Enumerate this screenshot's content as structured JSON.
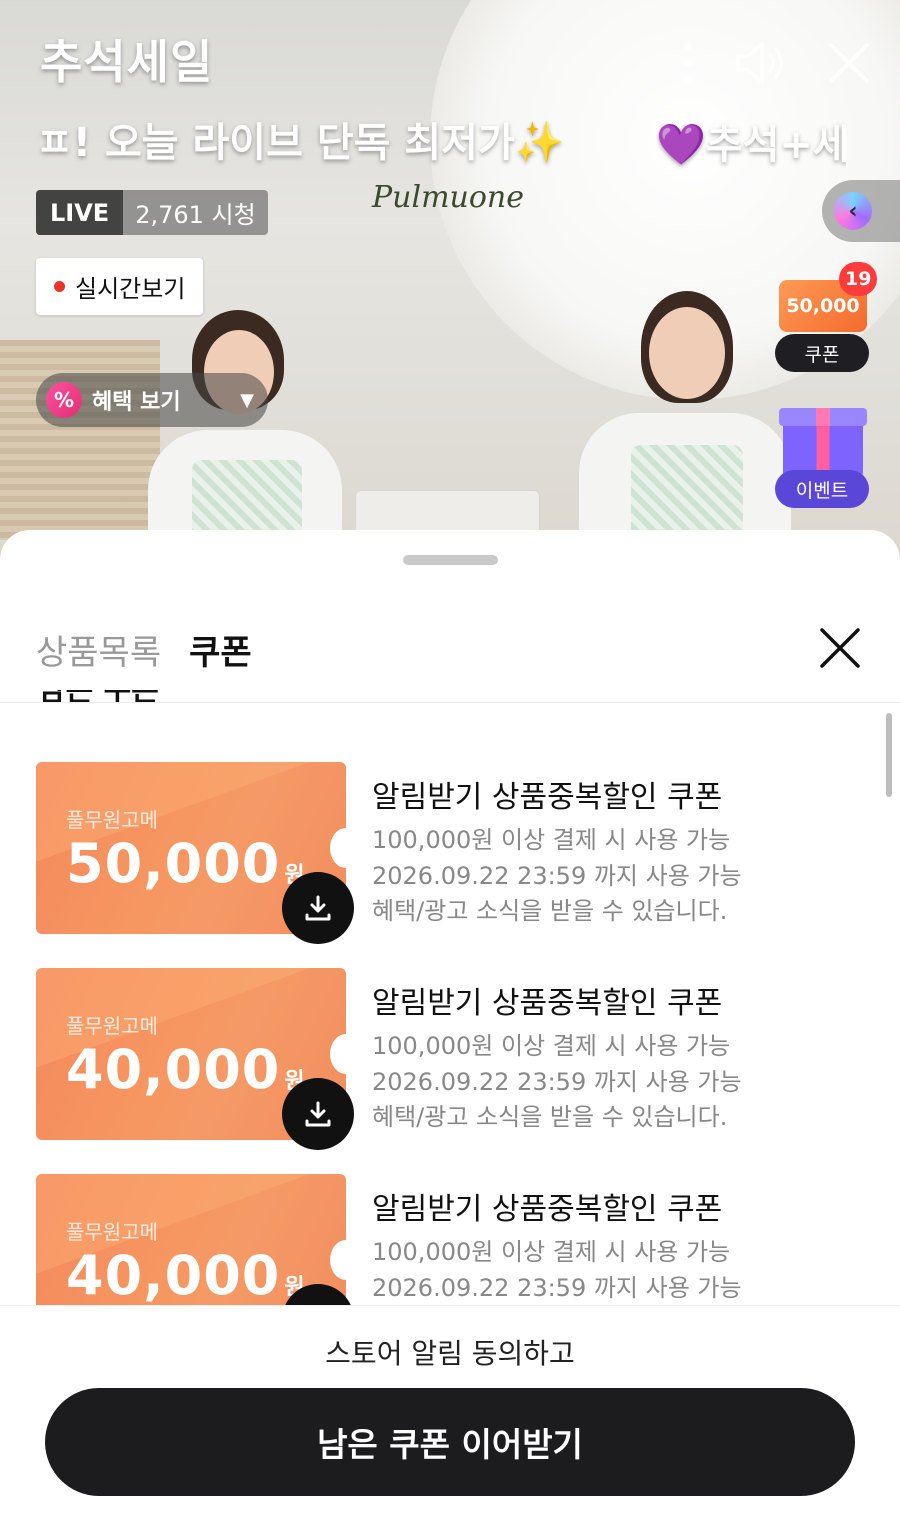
{
  "live": {
    "brand_title": "추석세일",
    "marquee_text": "ㅍ! 오늘 라이브 단독 최저가",
    "marquee_sparkle": "✨",
    "marquee_next": "추석+세",
    "marquee_heart": "💜",
    "logo_text": "Pulmuone",
    "live_label": "LIVE",
    "viewers": "2,761 시청",
    "realtime_button": "실시간보기",
    "benefit_button": "혜택 보기",
    "benefit_icon": "%",
    "coupon_widget": {
      "amount": "50,000",
      "badge_count": "19",
      "label": "쿠폰"
    },
    "event_widget": {
      "label": "이벤트"
    }
  },
  "sheet": {
    "tabs": [
      {
        "label": "상품목록",
        "active": false
      },
      {
        "label": "쿠폰",
        "active": true
      }
    ],
    "section_title": "남은 쿠폰",
    "coupons": [
      {
        "brand": "풀무원고메",
        "amount": "50,000",
        "unit": "원",
        "title": "알림받기 상품중복할인 쿠폰",
        "condition": "100,000원 이상 결제 시 사용 가능",
        "expiry": "2026.09.22 23:59 까지 사용 가능",
        "note": "혜택/광고 소식을 받을 수 있습니다."
      },
      {
        "brand": "풀무원고메",
        "amount": "40,000",
        "unit": "원",
        "title": "알림받기 상품중복할인 쿠폰",
        "condition": "100,000원 이상 결제 시 사용 가능",
        "expiry": "2026.09.22 23:59 까지 사용 가능",
        "note": "혜택/광고 소식을 받을 수 있습니다."
      },
      {
        "brand": "풀무원고메",
        "amount": "40,000",
        "unit": "원",
        "title": "알림받기 상품중복할인 쿠폰",
        "condition": "100,000원 이상 결제 시 사용 가능",
        "expiry": "2026.09.22 23:59 까지 사용 가능",
        "note": ""
      }
    ],
    "footer": {
      "consent_text": "스토어 알림 동의하고",
      "cta_label": "남은 쿠폰 이어받기"
    }
  },
  "colors": {
    "coupon_orange": "#f4905e",
    "cta_dark": "#1c1c1e",
    "live_red_dot": "#e8322a",
    "event_purple": "#5a47d8"
  },
  "icons": {
    "more": "more-vertical-icon",
    "sound": "speaker-icon",
    "close": "close-icon",
    "download": "download-icon",
    "collapse": "chevron-left-icon"
  }
}
